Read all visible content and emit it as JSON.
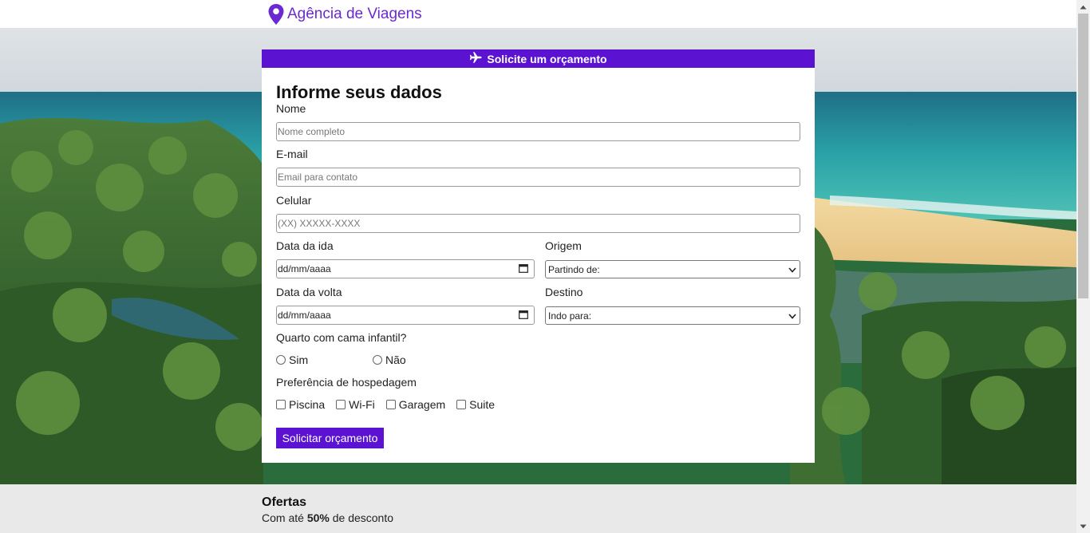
{
  "header": {
    "brand_name": "Agência de Viagens",
    "brand_icon": "map-pin-icon",
    "brand_color": "#6a2ad2"
  },
  "form": {
    "header_label": "Solicite um orçamento",
    "header_icon": "airplane-icon",
    "accent_color": "#5b12d1",
    "title": "Informe seus dados",
    "nome": {
      "label": "Nome",
      "placeholder": "Nome completo",
      "value": ""
    },
    "email": {
      "label": "E-mail",
      "placeholder": "Email para contato",
      "value": ""
    },
    "celular": {
      "label": "Celular",
      "placeholder": "(XX) XXXXX-XXXX",
      "value": ""
    },
    "data_ida": {
      "label": "Data da ida",
      "placeholder": "dd/mm/aaaa"
    },
    "origem": {
      "label": "Origem",
      "selected": "Partindo de:"
    },
    "data_volta": {
      "label": "Data da volta",
      "placeholder": "dd/mm/aaaa"
    },
    "destino": {
      "label": "Destino",
      "selected": "Indo para:"
    },
    "cama_infantil": {
      "label": "Quarto com cama infantil?",
      "options": [
        "Sim",
        "Não"
      ]
    },
    "hospedagem": {
      "label": "Preferência de hospedagem",
      "options": [
        "Piscina",
        "Wi-Fi",
        "Garagem",
        "Suite"
      ]
    },
    "submit_label": "Solicitar orçamento"
  },
  "offers": {
    "title": "Ofertas",
    "text_prefix": "Com até",
    "discount": "50%",
    "text_suffix": "de desconto"
  }
}
